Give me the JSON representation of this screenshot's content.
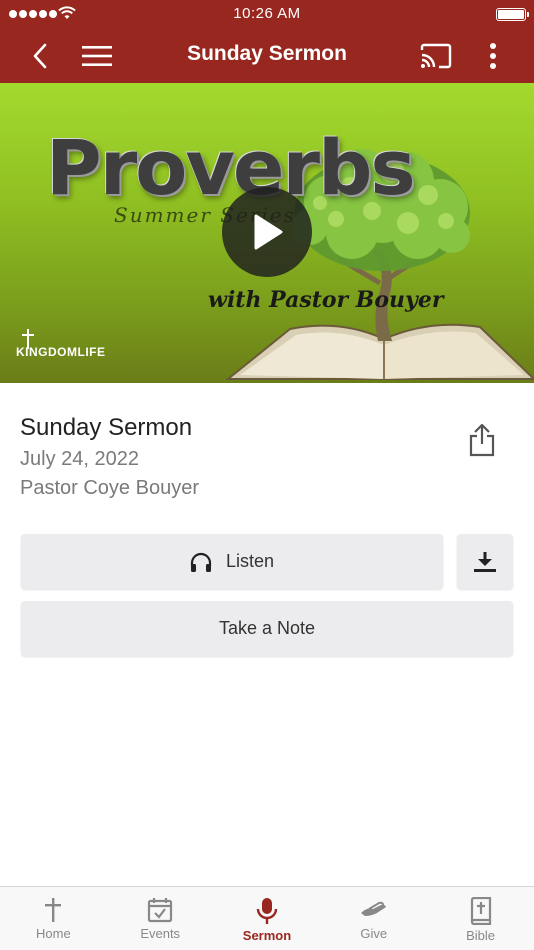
{
  "status_bar": {
    "time": "10:26 AM"
  },
  "nav": {
    "title": "Sunday Sermon"
  },
  "hero": {
    "title": "Proverbs",
    "subtitle": "Summer Series",
    "byline": "with Pastor Bouyer",
    "logo_text": "KINGDOMLIFE"
  },
  "sermon": {
    "title": "Sunday Sermon",
    "date": "July 24, 2022",
    "speaker": "Pastor Coye Bouyer"
  },
  "actions": {
    "listen_label": "Listen",
    "note_label": "Take a Note"
  },
  "tabs": [
    {
      "label": "Home",
      "icon": "cross-icon"
    },
    {
      "label": "Events",
      "icon": "calendar-check-icon"
    },
    {
      "label": "Sermon",
      "icon": "microphone-icon",
      "active": true
    },
    {
      "label": "Give",
      "icon": "giving-hand-icon"
    },
    {
      "label": "Bible",
      "icon": "bible-icon"
    }
  ],
  "colors": {
    "brand": "#98281f",
    "button_bg": "#ececee",
    "inactive_tab": "#888888"
  }
}
